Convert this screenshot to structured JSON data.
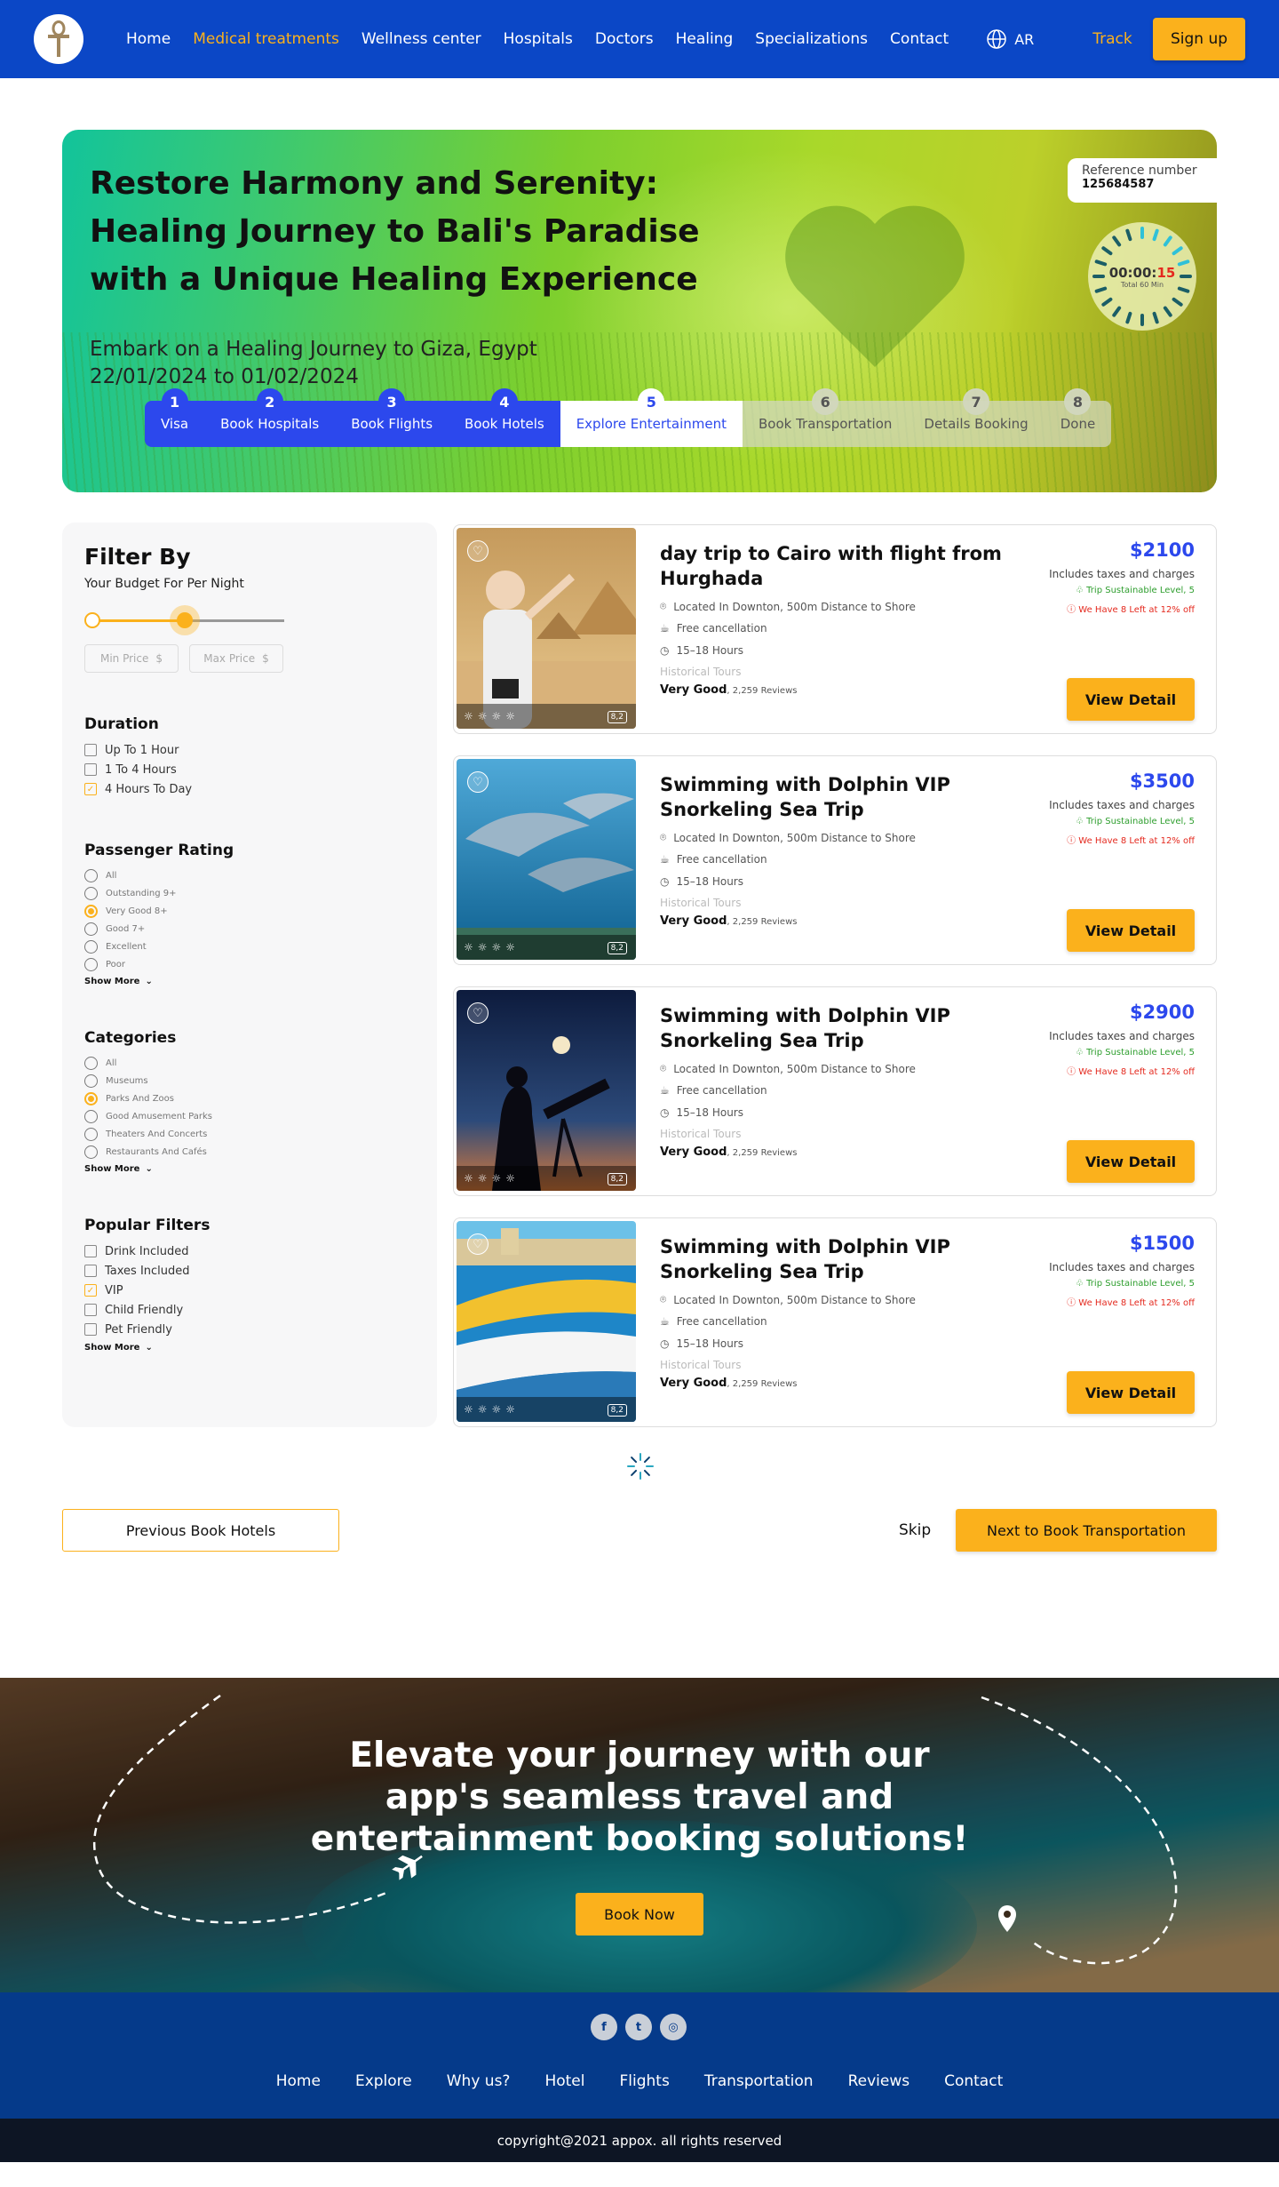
{
  "nav": {
    "items": [
      "Home",
      "Medical treatments",
      "Wellness center",
      "Hospitals",
      "Doctors",
      "Healing",
      "Specializations",
      "Contact"
    ],
    "active_index": 1,
    "lang": "AR",
    "track": "Track",
    "signup": "Sign up"
  },
  "hero": {
    "title": "Restore Harmony and Serenity: Healing Journey to Bali's Paradise with a Unique Healing Experience",
    "subtitle_line1": "Embark on a Healing Journey to Giza, Egypt",
    "subtitle_line2": "22/01/2024 to 01/02/2024",
    "ref_label": "Reference number",
    "ref_value": "125684587",
    "timer_main": "00:00:",
    "timer_sec": "15",
    "timer_total": "Total 60 Min",
    "progress_fraction": 0.25
  },
  "steps": [
    {
      "n": "1",
      "label": "Visa",
      "state": "done"
    },
    {
      "n": "2",
      "label": "Book Hospitals",
      "state": "done"
    },
    {
      "n": "3",
      "label": "Book Flights",
      "state": "done"
    },
    {
      "n": "4",
      "label": "Book Hotels",
      "state": "done"
    },
    {
      "n": "5",
      "label": "Explore Entertainment",
      "state": "current"
    },
    {
      "n": "6",
      "label": "Book Transportation",
      "state": "todo"
    },
    {
      "n": "7",
      "label": "Details Booking",
      "state": "todo"
    },
    {
      "n": "8",
      "label": "Done",
      "state": "todo"
    }
  ],
  "filter": {
    "title": "Filter By",
    "budget_label": "Your Budget For Per Night",
    "slider_min_fraction": 0.0,
    "slider_max_fraction": 0.5,
    "min_price": "Min Price",
    "max_price": "Max Price",
    "currency_icon": "$",
    "duration_title": "Duration",
    "duration": [
      {
        "label": "Up To 1 Hour",
        "checked": false
      },
      {
        "label": "1 To 4 Hours",
        "checked": false
      },
      {
        "label": "4 Hours To Day",
        "checked": true
      }
    ],
    "rating_title": "Passenger Rating",
    "ratings": [
      {
        "label": "All",
        "checked": false
      },
      {
        "label": "Outstanding 9+",
        "checked": false
      },
      {
        "label": "Very Good 8+",
        "checked": true
      },
      {
        "label": "Good 7+",
        "checked": false
      },
      {
        "label": "Excellent",
        "checked": false
      },
      {
        "label": "Poor",
        "checked": false
      }
    ],
    "show_more": "Show More",
    "categories_title": "Categories",
    "categories": [
      {
        "label": "All",
        "checked": false
      },
      {
        "label": "Museums",
        "checked": false
      },
      {
        "label": "Parks And Zoos",
        "checked": true
      },
      {
        "label": "Good Amusement Parks",
        "checked": false
      },
      {
        "label": "Theaters And Concerts",
        "checked": false
      },
      {
        "label": "Restaurants And Cafés",
        "checked": false
      }
    ],
    "popular_title": "Popular Filters",
    "popular": [
      {
        "label": "Drink Included",
        "checked": false
      },
      {
        "label": "Taxes Included",
        "checked": false
      },
      {
        "label": "VIP",
        "checked": true
      },
      {
        "label": "Child Friendly",
        "checked": false
      },
      {
        "label": "Pet Friendly",
        "checked": false
      }
    ]
  },
  "cards": [
    {
      "title": "day trip to Cairo with flight from Hurghada",
      "price": "$2100",
      "location": "Located In Downton, 500m Distance to Shore",
      "cancel": "Free cancellation",
      "hours": "15–18 Hours",
      "category": "Historical Tours",
      "rating": "Very Good",
      "reviews": ", 2,259 Reviews",
      "tax": "Includes taxes and charges",
      "sustain": "Trip Sustainable Level, 5",
      "left": "We Have 8 Left at 12% off",
      "score": "8,2",
      "button": "View Detail",
      "img": "pyramids"
    },
    {
      "title": "Swimming with Dolphin VIP Snorkeling Sea Trip",
      "price": "$3500",
      "location": "Located In Downton, 500m Distance to Shore",
      "cancel": "Free cancellation",
      "hours": "15–18 Hours",
      "category": "Historical Tours",
      "rating": "Very Good",
      "reviews": ", 2,259 Reviews",
      "tax": "Includes taxes and charges",
      "sustain": "Trip Sustainable Level, 5",
      "left": "We Have 8 Left at 12% off",
      "score": "8,2",
      "button": "View Detail",
      "img": "dolphins"
    },
    {
      "title": "Swimming with Dolphin VIP Snorkeling Sea Trip",
      "price": "$2900",
      "location": "Located In Downton, 500m Distance to Shore",
      "cancel": "Free cancellation",
      "hours": "15–18 Hours",
      "category": "Historical Tours",
      "rating": "Very Good",
      "reviews": ", 2,259 Reviews",
      "tax": "Includes taxes and charges",
      "sustain": "Trip Sustainable Level, 5",
      "left": "We Have 8 Left at 12% off",
      "score": "8,2",
      "button": "View Detail",
      "img": "telescope"
    },
    {
      "title": "Swimming with Dolphin VIP Snorkeling Sea Trip",
      "price": "$1500",
      "location": "Located In Downton, 500m Distance to Shore",
      "cancel": "Free cancellation",
      "hours": "15–18 Hours",
      "category": "Historical Tours",
      "rating": "Very Good",
      "reviews": ", 2,259 Reviews",
      "tax": "Includes taxes and charges",
      "sustain": "Trip Sustainable Level, 5",
      "left": "We Have 8 Left at 12% off",
      "score": "8,2",
      "button": "View Detail",
      "img": "boat"
    }
  ],
  "pager": {
    "prev": "Previous Book Hotels",
    "skip": "Skip",
    "next": "Next to  Book Transportation"
  },
  "cta": {
    "title": "Elevate your journey with our app's seamless travel and entertainment booking solutions!",
    "button": "Book Now"
  },
  "footer": {
    "social": [
      "facebook-icon",
      "twitter-icon",
      "instagram-icon"
    ],
    "links": [
      "Home",
      "Explore",
      "Why us?",
      "Hotel",
      "Flights",
      "Transportation",
      "Reviews",
      "Contact"
    ],
    "copyright": "copyright@2021 appox. all rights reserved"
  },
  "colors": {
    "primary": "#0b47c6",
    "accent": "#fbb11c",
    "step": "#2c48ed",
    "footer": "#053a8a"
  }
}
